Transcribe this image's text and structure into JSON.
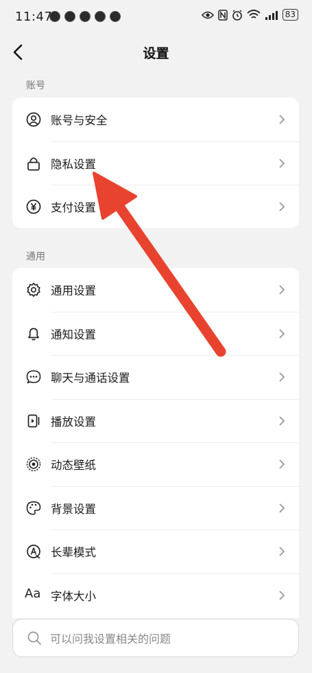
{
  "status_bar": {
    "time": "11:47",
    "battery": "83"
  },
  "header": {
    "title": "设置"
  },
  "sections": {
    "account": {
      "label": "账号",
      "items": [
        {
          "label": "账号与安全",
          "icon": "account-icon"
        },
        {
          "label": "隐私设置",
          "icon": "lock-icon"
        },
        {
          "label": "支付设置",
          "icon": "yuan-icon"
        }
      ]
    },
    "general": {
      "label": "通用",
      "items": [
        {
          "label": "通用设置",
          "icon": "gear-icon"
        },
        {
          "label": "通知设置",
          "icon": "bell-icon"
        },
        {
          "label": "聊天与通话设置",
          "icon": "chat-icon"
        },
        {
          "label": "播放设置",
          "icon": "play-icon"
        },
        {
          "label": "动态壁纸",
          "icon": "wallpaper-icon"
        },
        {
          "label": "背景设置",
          "icon": "palette-icon"
        },
        {
          "label": "长辈模式",
          "icon": "elder-mode-icon"
        },
        {
          "label": "字体大小",
          "icon": "font-size-icon",
          "glyph": "Aa"
        }
      ]
    }
  },
  "search": {
    "placeholder": "可以问我设置相关的问题"
  },
  "colors": {
    "annotation_arrow": "#e8432f",
    "background": "#f2f2f2",
    "card": "#ffffff"
  }
}
